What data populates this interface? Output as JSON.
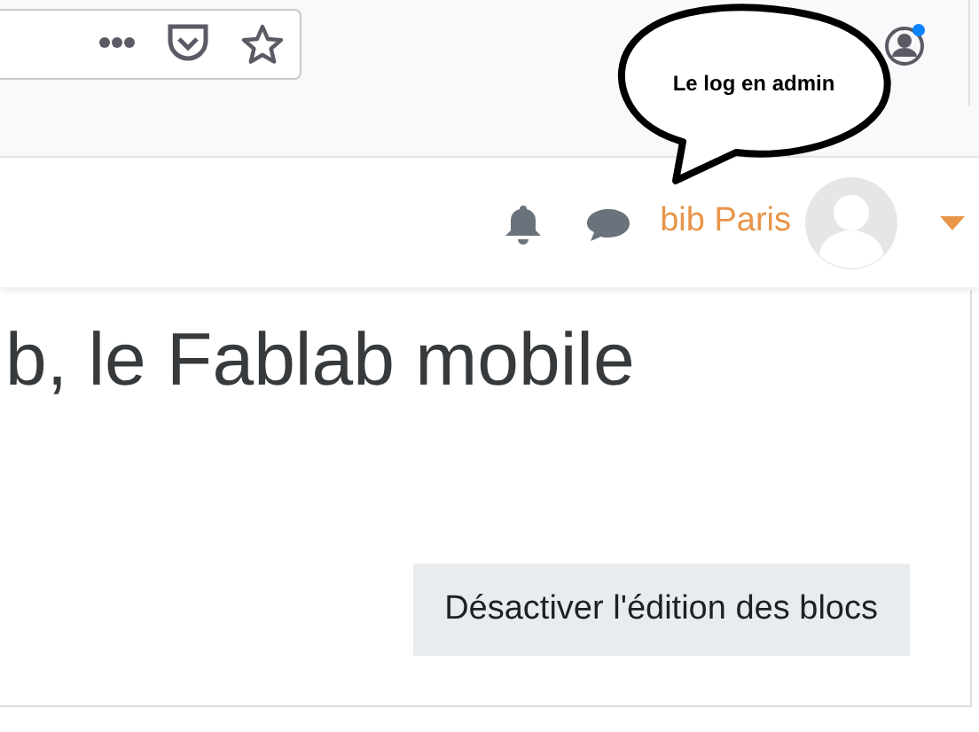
{
  "annotation": {
    "text": "Le log en admin"
  },
  "navbar": {
    "user_name": "bib Paris"
  },
  "page": {
    "title": "b, le Fablab mobile",
    "edit_button": "Désactiver l'édition des blocs"
  }
}
